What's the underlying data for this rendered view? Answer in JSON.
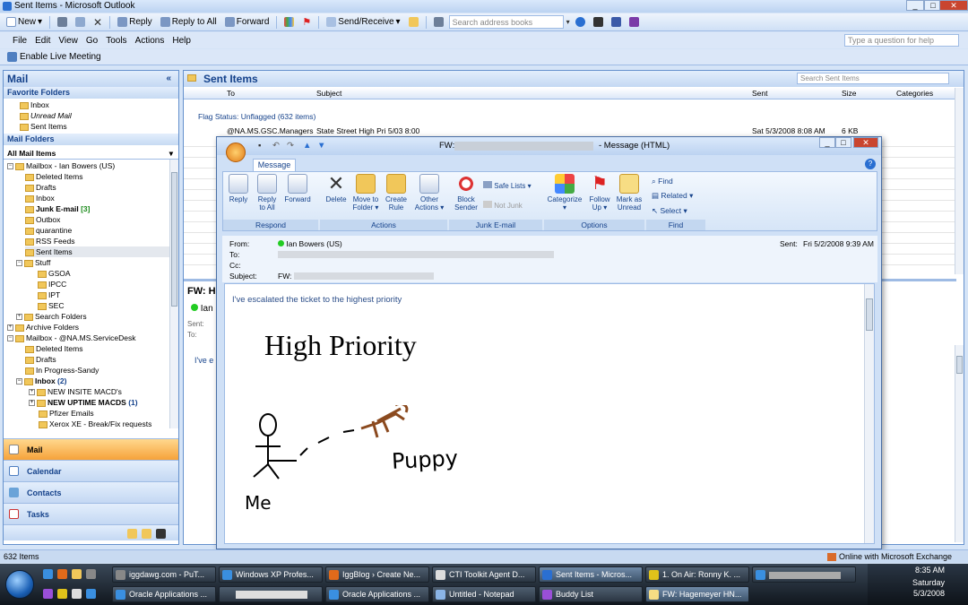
{
  "window": {
    "title": "Sent Items - Microsoft Outlook",
    "min": "_",
    "max": "□",
    "close": "✕"
  },
  "toolbar": {
    "new": "New",
    "reply": "Reply",
    "reply_all": "Reply to All",
    "forward": "Forward",
    "send_receive": "Send/Receive",
    "search_placeholder": "Search address books"
  },
  "menu": {
    "items": [
      "File",
      "Edit",
      "View",
      "Go",
      "Tools",
      "Actions",
      "Help"
    ],
    "question_placeholder": "Type a question for help"
  },
  "live": {
    "label": "Enable Live Meeting"
  },
  "nav": {
    "title": "Mail",
    "favorite_header": "Favorite Folders",
    "favorites": [
      "Inbox",
      "Unread Mail",
      "Sent Items"
    ],
    "folders_header": "Mail Folders",
    "all_items": "All Mail Items",
    "mailbox1": "Mailbox - Ian Bowers (US)",
    "mb1_folders": [
      "Deleted Items",
      "Drafts",
      "Inbox",
      "Junk E-mail",
      "Outbox",
      "quarantine",
      "RSS Feeds",
      "Sent Items",
      "Stuff"
    ],
    "junk_count": "[3]",
    "stuff_children": [
      "GSOA",
      "IPCC",
      "IPT",
      "SEC"
    ],
    "search_folders": "Search Folders",
    "archive": "Archive Folders",
    "mailbox2": "Mailbox - @NA.MS.ServiceDesk",
    "mb2_folders": [
      "Deleted Items",
      "Drafts",
      "In Progress-Sandy",
      "Inbox"
    ],
    "mb2_inbox_count": "(2)",
    "mb2_inbox_children": [
      "NEW INSITE MACD's",
      "NEW UPTIME MACDS",
      "Pfizer Emails",
      "Xerox XE - Break/Fix requests"
    ],
    "uptime_count": "(1)",
    "buttons": [
      "Mail",
      "Calendar",
      "Contacts",
      "Tasks"
    ]
  },
  "main": {
    "title": "Sent Items",
    "search_placeholder": "Search Sent Items",
    "columns": {
      "to": "To",
      "subject": "Subject",
      "sent": "Sent",
      "size": "Size",
      "categories": "Categories"
    },
    "group": "Flag Status: Unflagged (632 items)",
    "row1": {
      "to": "@NA.MS.GSC.Managers",
      "subject": "State Street High Pri 5/03 8:00",
      "sent": "Sat 5/3/2008 8:08 AM",
      "size": "6 KB"
    },
    "preview_subject": "FW: H",
    "preview_from": "Ian",
    "preview_sent": "Sent:",
    "preview_to": "To:",
    "preview_body": "I've e"
  },
  "msg": {
    "title_prefix": "FW:",
    "title_suffix": "- Message (HTML)",
    "tab": "Message",
    "buttons": {
      "reply": "Reply",
      "reply_all": "Reply\nto All",
      "forward": "Forward",
      "delete": "Delete",
      "move": "Move to\nFolder ▾",
      "create_rule": "Create\nRule",
      "other": "Other\nActions ▾",
      "block": "Block\nSender",
      "safe_lists": "Safe Lists ▾",
      "not_junk": "Not Junk",
      "categorize": "Categorize\n▾",
      "follow_up": "Follow\nUp ▾",
      "mark_unread": "Mark as\nUnread",
      "find": "Find",
      "related": "Related ▾",
      "select": "Select ▾"
    },
    "groups": [
      "Respond",
      "Actions",
      "Junk E-mail",
      "Options",
      "Find"
    ],
    "from_label": "From:",
    "from_value": "Ian Bowers (US)",
    "to_label": "To:",
    "cc_label": "Cc:",
    "subject_label": "Subject:",
    "subject_value": "FW:",
    "sent_label": "Sent:",
    "sent_value": "Fri 5/2/2008 9:39 AM",
    "body_line": "I've escalated the ticket to the highest priority",
    "heading": "High Priority",
    "me": "Me",
    "puppy": "Puppy"
  },
  "status": {
    "items": "632 Items",
    "exchange": "Online with Microsoft Exchange"
  },
  "taskbar": {
    "row1": [
      "iggdawg.com - PuT...",
      "Windows XP Profes...",
      "IggBlog › Create Ne...",
      "CTI Toolkit Agent D...",
      "Sent Items - Micros...",
      "1. On Air: Ronny K. ..."
    ],
    "row2": [
      "Oracle Applications ...",
      "Oracle Applications ...",
      "Untitled - Notepad",
      "Buddy List",
      "FW: Hagemeyer HN..."
    ],
    "time": "8:35 AM",
    "day": "Saturday",
    "date": "5/3/2008"
  },
  "colors": {
    "accent": "#15428b",
    "active_nav": "#f6a23a",
    "title_blue": "#cfe0f6"
  }
}
